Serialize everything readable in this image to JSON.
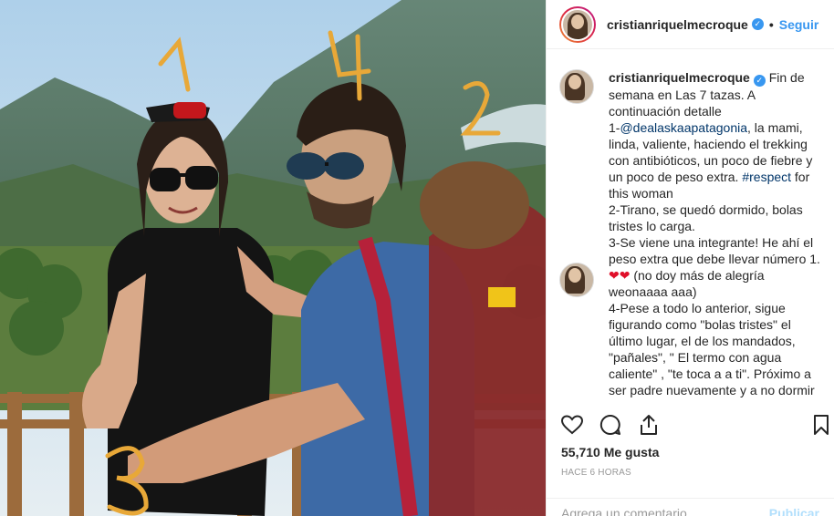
{
  "post": {
    "username": "cristianriquelmecroque",
    "verified_icon": "verified-badge-icon",
    "separator": "•",
    "follow_label": "Seguir",
    "caption": {
      "username": "cristianriquelmecroque",
      "line1": " Fin de semana en Las 7 tazas. A continuación detalle",
      "p1_prefix": "1-",
      "p1_mention": "@dealaskaapatagonia",
      "p1_text": ", la mami, linda, valiente, haciendo el trekking con antibióticos, un poco de fiebre y un poco de peso extra. ",
      "p1_hashtag": "#respect",
      "p1_suffix": " for this woman",
      "p2": "2-Tirano, se quedó dormido, bolas tristes lo carga.",
      "p3": "3-Se viene una integrante! He ahí el peso extra que debe llevar número 1. ",
      "hearts": "❤❤",
      "p3_suffix": " (no doy más de alegría weonaaaa aaa)",
      "p4": "4-Pese a todo lo anterior, sigue figurando como \"bolas tristes\" el último lugar, el de los mandados, \"pañales\", \" El termo con agua caliente\" , \"te toca a a ti\". Próximo a ser padre nuevamente y a no dormir"
    },
    "likes": "55,710 Me gusta",
    "time": "HACE 6 HORAS",
    "comment_placeholder": "Agrega un comentario...",
    "publish_label": "Publicar"
  },
  "photo": {
    "annotations": [
      "1",
      "4",
      "2",
      "3"
    ]
  },
  "icons": {
    "like": "heart-icon",
    "comment": "comment-icon",
    "share": "share-icon",
    "save": "bookmark-icon"
  },
  "colors": {
    "link": "#003569",
    "follow": "#3897f0",
    "annotation": "#e8a838"
  }
}
